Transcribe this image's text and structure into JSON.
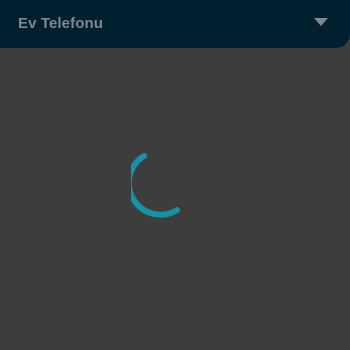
{
  "dropdown": {
    "title": "Ev Telefonu",
    "icon": "chevron-down-icon"
  },
  "loader": {
    "icon": "loading-spinner-icon",
    "state": "loading"
  },
  "colors": {
    "background": "#3d3d3d",
    "header_background": "#00202f",
    "header_text": "#7d8991",
    "spinner": "#1592a7"
  }
}
